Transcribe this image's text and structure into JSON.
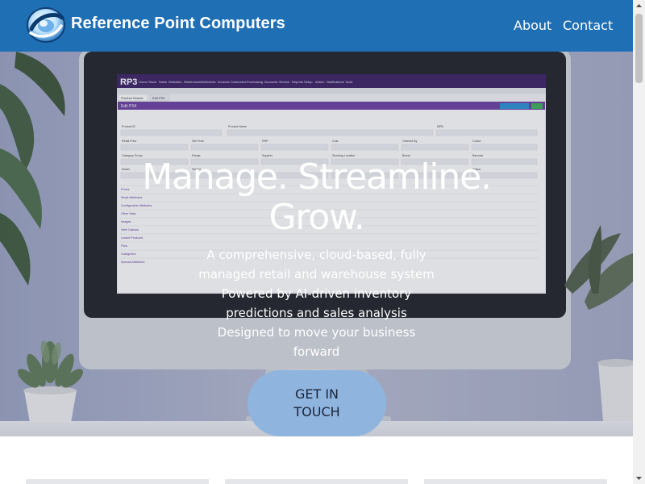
{
  "header": {
    "brand": "Reference Point Computers",
    "nav": [
      {
        "label": "About"
      },
      {
        "label": "Contact"
      }
    ],
    "background": "#1f6fb5"
  },
  "hero": {
    "title_line1": "Manage. Streamline.",
    "title_line2": "Grow.",
    "subtitle_lines": [
      "A comprehensive, cloud-based, fully",
      "managed retail and warehouse system",
      "Powered by AI-driven inventory",
      "predictions and sales analysis",
      "Designed to move your business",
      "forward"
    ],
    "cta_line1": "GET IN",
    "cta_line2": "TOUCH",
    "cta_color": "#8fb4de",
    "screen_app": {
      "logo": "RP3",
      "menu": [
        "Home",
        "Stock",
        "Sales",
        "Websites",
        "Warehouses",
        "Deliveries",
        "Invoices",
        "Customers",
        "Purchasing",
        "Accounts",
        "Service",
        "Reports",
        "Setup",
        "Admin",
        "Notifications",
        "Tools"
      ],
      "tabs": [
        "Product Search",
        "Edit PS4"
      ],
      "panel_title": "Edit PS4",
      "fields": [
        "Product ID",
        "Product Name",
        "MPN",
        "Retail Price",
        "Sell Price",
        "RRP",
        "Cost",
        "Ordered By",
        "Colour",
        "Category Group",
        "Range",
        "Supplier",
        "Stocking Location",
        "Brand",
        "Barcode",
        "Model",
        "Weight",
        "Status"
      ],
      "sections": [
        "Prices",
        "Stock Attributes",
        "Configurable Attributes",
        "Other Data",
        "Images",
        "Web Options",
        "Linked Products",
        "Files",
        "Categories",
        "Special Attributes"
      ]
    }
  },
  "icons": {
    "logo": "globe-swoosh-logo-icon",
    "scroll_up": "scroll-up-arrow-icon",
    "scroll_down": "scroll-down-arrow-icon"
  }
}
